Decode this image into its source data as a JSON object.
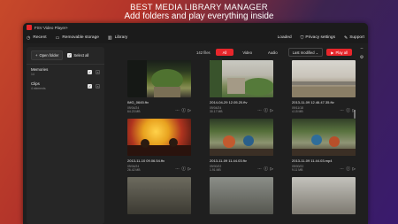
{
  "promo": {
    "line1": "BEST MEDIA LIBRARY MANAGER",
    "line2": "Add folders and play everything inside"
  },
  "window": {
    "title": "FSV Video Player+"
  },
  "nav": {
    "recent": "Recent",
    "removable": "Removable storage",
    "library": "Library",
    "loaded": "Loaded",
    "privacy": "Privacy settings",
    "support": "Support"
  },
  "sidebar": {
    "open_folder": "Open folder",
    "select_all": "Select all",
    "folders": [
      {
        "name": "Memories",
        "count": "14"
      },
      {
        "name": "Clips",
        "count": "4 elements"
      }
    ]
  },
  "filters": {
    "files_count": "142 files",
    "tabs": [
      "All",
      "Video",
      "Audio"
    ],
    "active": "All",
    "sort": "Last modified",
    "play_all": "Play all"
  },
  "colors": {
    "accent": "#e8262b",
    "window_bg": "#1f1f1f",
    "sidebar_bg": "#262626"
  },
  "icons": [
    "recent-icon",
    "usb-icon",
    "library-icon",
    "shield-icon",
    "support-icon",
    "folder-icon",
    "play-icon",
    "info-icon",
    "settings-icon"
  ],
  "media": [
    {
      "name": "IMG_0645.ftv",
      "date": "09/04/24",
      "size": "64.23 MB"
    },
    {
      "name": "2014-04-29 12.05.20.ftv",
      "date": "09/04/24",
      "size": "30.17 MB"
    },
    {
      "name": "2013-11-09 12.46.47.35.ftv",
      "date": "09/11/18",
      "size": "4.15 MB"
    },
    {
      "name": "2013-11-10 09.06.54.ftv",
      "date": "09/04/24",
      "size": "26.42 MB"
    },
    {
      "name": "2013-11-09 11.44.03.ftv",
      "date": "09/00/22",
      "size": "1.91 MB"
    },
    {
      "name": "2013-11-09 11.44.03.mp4",
      "date": "09/00/22",
      "size": "9.11 MB"
    }
  ]
}
